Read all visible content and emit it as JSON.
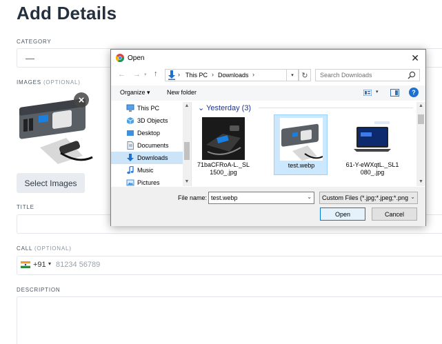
{
  "page": {
    "title": "Add Details",
    "category": {
      "label": "CATEGORY",
      "value": "—"
    },
    "images": {
      "label": "IMAGES",
      "optional": "(OPTIONAL)",
      "remove_icon": "close-icon",
      "select_button": "Select Images"
    },
    "title_field": {
      "label": "TITLE"
    },
    "call": {
      "label": "CALL",
      "optional": "(OPTIONAL)",
      "dial_code": "+91",
      "placeholder": "81234 56789"
    },
    "description": {
      "label": "DESCRIPTION"
    }
  },
  "dialog": {
    "title": "Open",
    "close_glyph": "✕",
    "nav": {
      "back": "←",
      "forward": "→",
      "up": "↑",
      "refresh": "↻"
    },
    "address": [
      "This PC",
      "Downloads"
    ],
    "search_placeholder": "Search Downloads",
    "toolbar": {
      "organize": "Organize ▾",
      "new_folder": "New folder",
      "help": "?"
    },
    "nav_items": [
      {
        "label": "This PC",
        "icon": "computer-icon"
      },
      {
        "label": "3D Objects",
        "icon": "cube-icon"
      },
      {
        "label": "Desktop",
        "icon": "desktop-icon"
      },
      {
        "label": "Documents",
        "icon": "document-icon"
      },
      {
        "label": "Downloads",
        "icon": "download-icon",
        "selected": true
      },
      {
        "label": "Music",
        "icon": "music-icon"
      },
      {
        "label": "Pictures",
        "icon": "picture-icon"
      }
    ],
    "group_header": "Yesterday (3)",
    "group_chevron": "⌄",
    "files": [
      {
        "name": "71baCFRoA-L._SL1500_.jpg",
        "selected": false
      },
      {
        "name": "test.webp",
        "selected": true
      },
      {
        "name": "61-Y-eWXqtL._SL1080_.jpg",
        "selected": false
      }
    ],
    "file_name_label": "File name:",
    "file_name_value": "test.webp",
    "filter_value": "Custom Files (*.jpg;*.jpeg;*.png",
    "open_button": "Open",
    "cancel_button": "Cancel",
    "colors": {
      "accent": "#0078d7",
      "selection": "#cce8ff",
      "header": "#1e3287"
    }
  }
}
